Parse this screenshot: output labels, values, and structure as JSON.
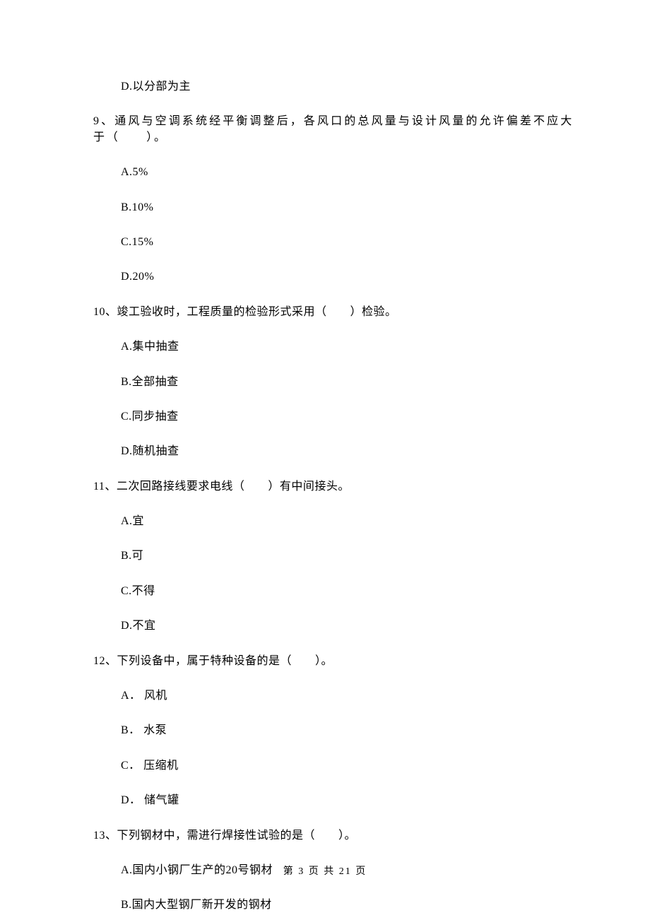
{
  "d_option_q_prev": "D.以分部为主",
  "q9": {
    "text": "9、通风与空调系统经平衡调整后，各风口的总风量与设计风量的允许偏差不应大于（　　）。",
    "a": "A.5%",
    "b": "B.10%",
    "c": "C.15%",
    "d": "D.20%"
  },
  "q10": {
    "text": "10、竣工验收时，工程质量的检验形式采用（　　）检验。",
    "a": "A.集中抽查",
    "b": "B.全部抽查",
    "c": "C.同步抽查",
    "d": "D.随机抽查"
  },
  "q11": {
    "text": "11、二次回路接线要求电线（　　）有中间接头。",
    "a": "A.宜",
    "b": "B.可",
    "c": "C.不得",
    "d": "D.不宜"
  },
  "q12": {
    "text": "12、下列设备中，属于特种设备的是（　　）。",
    "a": "A． 风机",
    "b": "B． 水泵",
    "c": "C． 压缩机",
    "d": "D． 储气罐"
  },
  "q13": {
    "text": "13、下列钢材中，需进行焊接性试验的是（　　）。",
    "a": "A.国内小钢厂生产的20号钢材",
    "b": "B.国内大型钢厂新开发的钢材"
  },
  "footer": "第 3 页 共 21 页"
}
